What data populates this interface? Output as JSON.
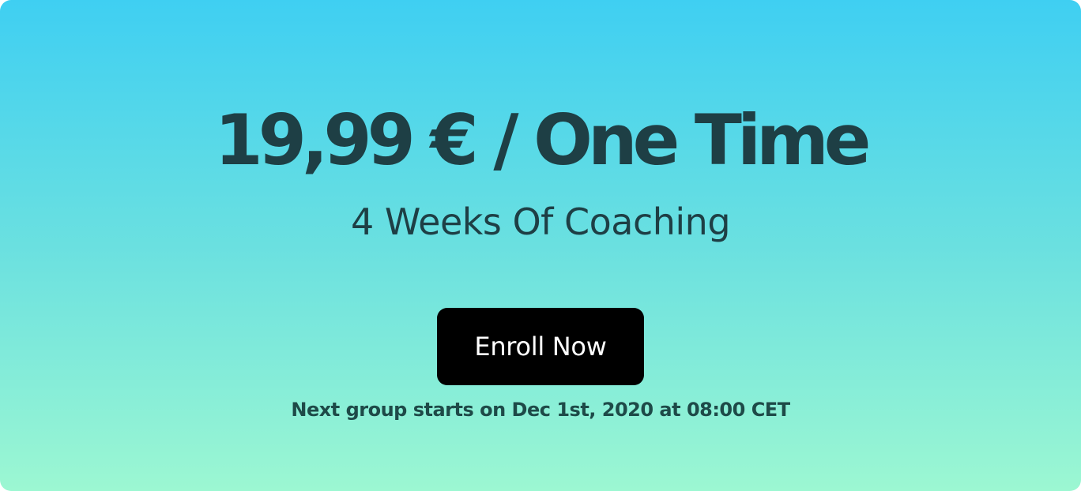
{
  "pricing": {
    "price_line": "19,99 € / One Time",
    "subtitle": "4 Weeks Of Coaching",
    "enroll_label": "Enroll Now",
    "schedule_note": "Next group starts on Dec 1st, 2020 at 08:00 CET"
  },
  "colors": {
    "gradient_top": "#3fcff2",
    "gradient_bottom": "#9cf7d2",
    "heading_text": "#1e3f45",
    "button_background": "#000000",
    "button_text": "#ffffff"
  }
}
